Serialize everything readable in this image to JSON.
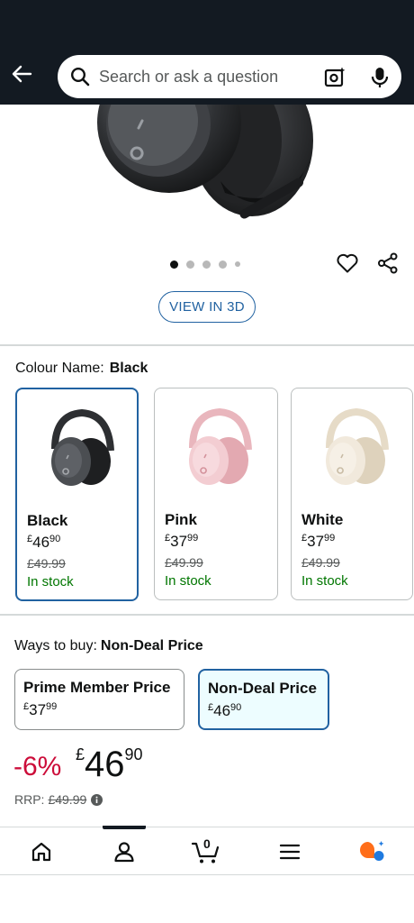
{
  "header": {
    "search_placeholder": "Search or ask a question",
    "icons": [
      "back-arrow-icon",
      "search-icon",
      "camera-search-icon",
      "microphone-icon"
    ]
  },
  "gallery": {
    "dots_total": 5,
    "active_index": 0,
    "view_3d_label": "VIEW IN 3D"
  },
  "colour": {
    "label": "Colour Name:",
    "selected": "Black",
    "options": [
      {
        "name": "Black",
        "currency": "£",
        "whole": "46",
        "fraction": "90",
        "rrp": "£49.99",
        "stock": "In stock",
        "color": "#3a3c3f"
      },
      {
        "name": "Pink",
        "currency": "£",
        "whole": "37",
        "fraction": "99",
        "rrp": "£49.99",
        "stock": "In stock",
        "color": "#f2c9cf"
      },
      {
        "name": "White",
        "currency": "£",
        "whole": "37",
        "fraction": "99",
        "rrp": "£49.99",
        "stock": "In stock",
        "color": "#efe6d6"
      }
    ]
  },
  "ways_to_buy": {
    "label": "Ways to buy:",
    "selected": "Non-Deal Price",
    "options": [
      {
        "title": "Prime Member Price",
        "currency": "£",
        "whole": "37",
        "fraction": "99"
      },
      {
        "title": "Non-Deal Price",
        "currency": "£",
        "whole": "46",
        "fraction": "90"
      }
    ]
  },
  "price": {
    "discount": "-6%",
    "currency": "£",
    "whole": "46",
    "fraction": "90",
    "rrp_label": "RRP:",
    "rrp_value": "£49.99"
  },
  "bottom_nav": {
    "cart_count": "0",
    "items": [
      "home-icon",
      "account-icon",
      "cart-icon",
      "menu-icon",
      "rufus-assistant-icon"
    ],
    "active": "account-icon"
  },
  "colors": {
    "header_bg": "#131a22",
    "link_blue": "#2162a1",
    "deal_red": "#cc0c39",
    "stock_green": "#007600",
    "selected_bg": "#edfdff"
  }
}
